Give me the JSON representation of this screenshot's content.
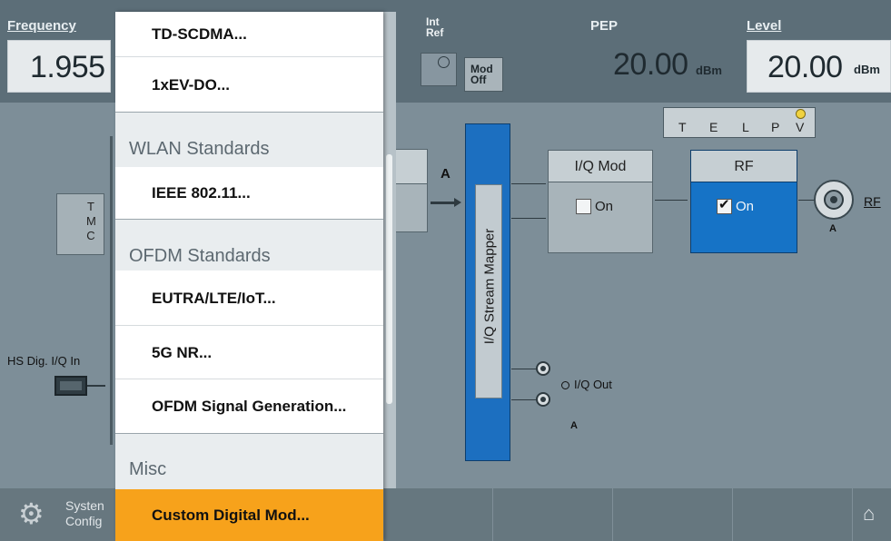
{
  "header": {
    "frequency_label": "Frequency",
    "frequency_value": "1.955",
    "int_ref_label": "Int Ref",
    "mod_off_label": "Mod Off",
    "pep_label": "PEP",
    "pep_value": "20.00",
    "pep_unit": "dBm",
    "level_label": "Level",
    "level_value": "20.00",
    "level_unit": "dBm"
  },
  "status_letters": [
    "T",
    "E",
    "L",
    "P",
    "V"
  ],
  "diagram": {
    "tmc_label": "T M C",
    "hs_dig_label": "HS Dig. I/Q In",
    "path_a_label": "A",
    "stream_mapper_label": "I/Q Stream Mapper",
    "iq_mod_title": "I/Q Mod",
    "iq_mod_on": "On",
    "rf_title": "RF",
    "rf_on": "On",
    "rf_connector_label": "RF",
    "rf_connector_sub": "A",
    "iq_out_label": "I/Q Out",
    "iq_out_sub": "A"
  },
  "menu": {
    "items": [
      {
        "type": "item",
        "label": "TD-SCDMA..."
      },
      {
        "type": "item",
        "label": "1xEV-DO..."
      },
      {
        "type": "header",
        "label": "WLAN Standards"
      },
      {
        "type": "item",
        "label": "IEEE 802.11..."
      },
      {
        "type": "header",
        "label": "OFDM Standards"
      },
      {
        "type": "item",
        "label": "EUTRA/LTE/IoT..."
      },
      {
        "type": "item",
        "label": "5G NR..."
      },
      {
        "type": "item",
        "label": "OFDM Signal Generation..."
      },
      {
        "type": "header",
        "label": "Misc"
      },
      {
        "type": "item",
        "label": "Custom Digital Mod...",
        "selected": true
      }
    ]
  },
  "footer": {
    "system_config_label_1": "Systen",
    "system_config_label_2": "Config"
  },
  "colors": {
    "highlight": "#f7a21b",
    "rf_active": "#1673c6",
    "mapper_blue": "#1c6fc0"
  }
}
